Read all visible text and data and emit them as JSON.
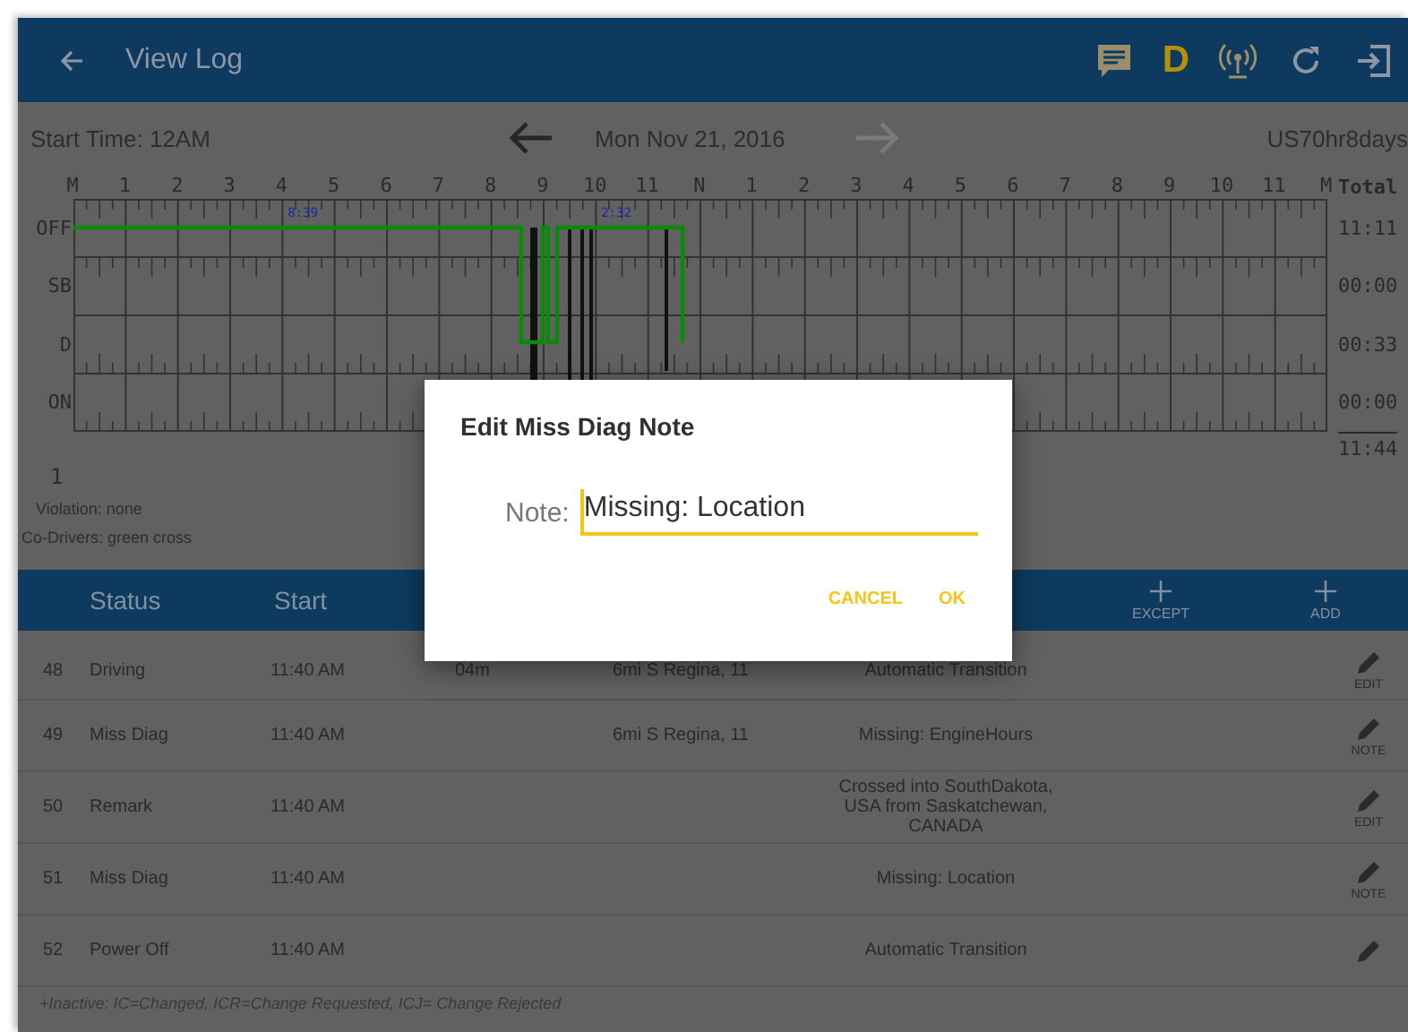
{
  "header": {
    "title": "View Log",
    "status_letter": "D"
  },
  "day_bar": {
    "start_time": "Start Time: 12AM",
    "date": "Mon Nov 21, 2016",
    "next_disabled": true,
    "rule_set": "US70hr8days"
  },
  "graph": {
    "hour_labels": [
      "M",
      "1",
      "2",
      "3",
      "4",
      "5",
      "6",
      "7",
      "8",
      "9",
      "10",
      "11",
      "N",
      "1",
      "2",
      "3",
      "4",
      "5",
      "6",
      "7",
      "8",
      "9",
      "10",
      "11",
      "M"
    ],
    "status_labels": [
      "OFF",
      "SB",
      "D",
      "ON"
    ],
    "segment_labels": [
      "8:39",
      "2:32"
    ],
    "total_heading": "Total",
    "totals": [
      "11:11",
      "00:00",
      "00:33",
      "00:00"
    ],
    "grand_total": "11:44",
    "page_number": "1"
  },
  "violation": "Violation: none",
  "co_drivers": "Co-Drivers: green cross",
  "table": {
    "columns": [
      "Status",
      "Start"
    ],
    "header_buttons": [
      {
        "label": "EXCEPT"
      },
      {
        "label": "ADD"
      }
    ],
    "rows": [
      {
        "number": "48",
        "status": "Driving",
        "start": "11:40 AM",
        "duration": "04m",
        "location": "6mi S Regina, 11",
        "notes": "Automatic Transition",
        "action": "EDIT"
      },
      {
        "number": "49",
        "status": "Miss Diag",
        "start": "11:40 AM",
        "location": "6mi S Regina, 11",
        "notes": "Missing: EngineHours",
        "action": "NOTE"
      },
      {
        "number": "50",
        "status": "Remark",
        "start": "11:40 AM",
        "notes": "Crossed into SouthDakota, USA from Saskatchewan, CANADA",
        "action": "EDIT"
      },
      {
        "number": "51",
        "status": "Miss Diag",
        "start": "11:40 AM",
        "notes": "Missing: Location",
        "action": "NOTE"
      },
      {
        "number": "52",
        "status": "Power Off",
        "start": "11:40 AM",
        "notes": "Automatic Transition"
      }
    ],
    "legend": "+Inactive: IC=Changed, ICR=Change Requested, ICJ= Change Rejected"
  },
  "dialog": {
    "title": "Edit Miss Diag Note",
    "label": "Note:",
    "value": "Missing: Location",
    "buttons": [
      "CANCEL",
      "OK"
    ]
  }
}
